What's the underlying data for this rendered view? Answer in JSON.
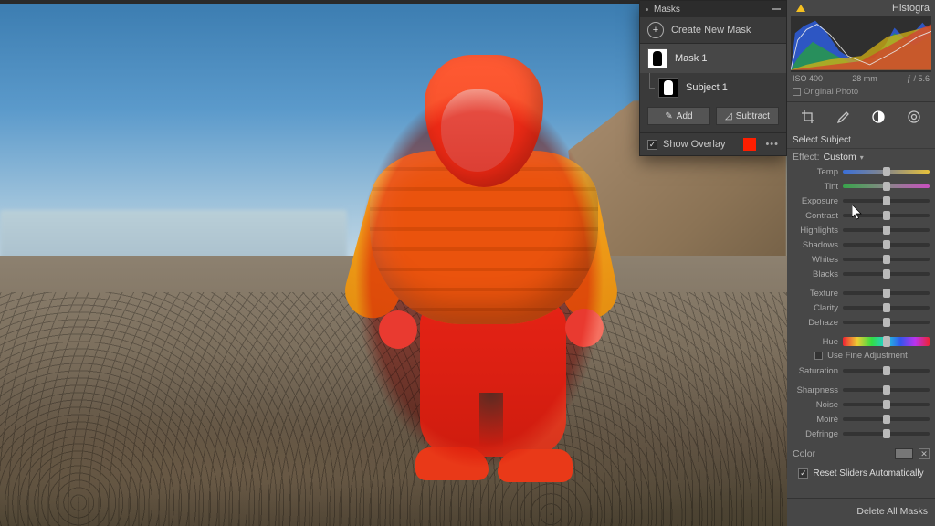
{
  "masks_panel": {
    "title": "Masks",
    "create_label": "Create New Mask",
    "items": [
      {
        "label": "Mask 1"
      },
      {
        "label": "Subject 1"
      }
    ],
    "add_btn": "Add",
    "subtract_btn": "Subtract",
    "show_overlay_label": "Show Overlay",
    "show_overlay_checked": "✓",
    "overlay_color": "#ff1e00"
  },
  "right_panel": {
    "histogram_title": "Histogra",
    "info": {
      "iso": "ISO 400",
      "focal": "28 mm",
      "aperture": "ƒ / 5.6"
    },
    "original_label": "Original Photo",
    "section_title": "Select Subject",
    "effect_label": "Effect:",
    "effect_value": "Custom",
    "fine_adjust_label": "Use Fine Adjustment",
    "color_label": "Color",
    "reset_label": "Reset Sliders Automatically",
    "reset_checked": "✓",
    "delete_label": "Delete All Masks",
    "sliders": {
      "temp": "Temp",
      "tint": "Tint",
      "exposure": "Exposure",
      "contrast": "Contrast",
      "highlights": "Highlights",
      "shadows": "Shadows",
      "whites": "Whites",
      "blacks": "Blacks",
      "texture": "Texture",
      "clarity": "Clarity",
      "dehaze": "Dehaze",
      "hue": "Hue",
      "saturation": "Saturation",
      "sharpness": "Sharpness",
      "noise": "Noise",
      "moire": "Moiré",
      "defringe": "Defringe"
    }
  }
}
